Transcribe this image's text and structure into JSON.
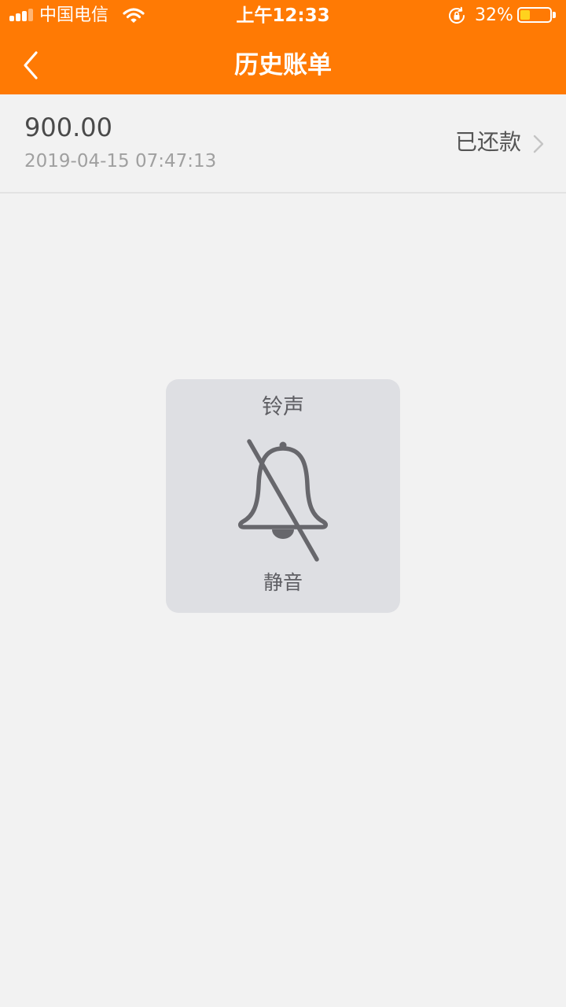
{
  "status_bar": {
    "carrier": "中国电信",
    "time": "上午12:33",
    "battery_percent": "32%",
    "battery_level": 0.32,
    "signal_bars": 3,
    "signal_total": 4
  },
  "nav": {
    "title": "历史账单",
    "back_icon": "chevron-left-icon"
  },
  "bills": [
    {
      "amount": "900.00",
      "date": "2019-04-15 07:47:13",
      "status": "已还款"
    }
  ],
  "hud": {
    "title": "铃声",
    "label": "静音",
    "icon": "bell-slash-icon"
  },
  "colors": {
    "accent": "#ff7a04",
    "background": "#f2f2f2",
    "battery_fill": "#ffd21e",
    "hud_background": "#dedfe3"
  }
}
